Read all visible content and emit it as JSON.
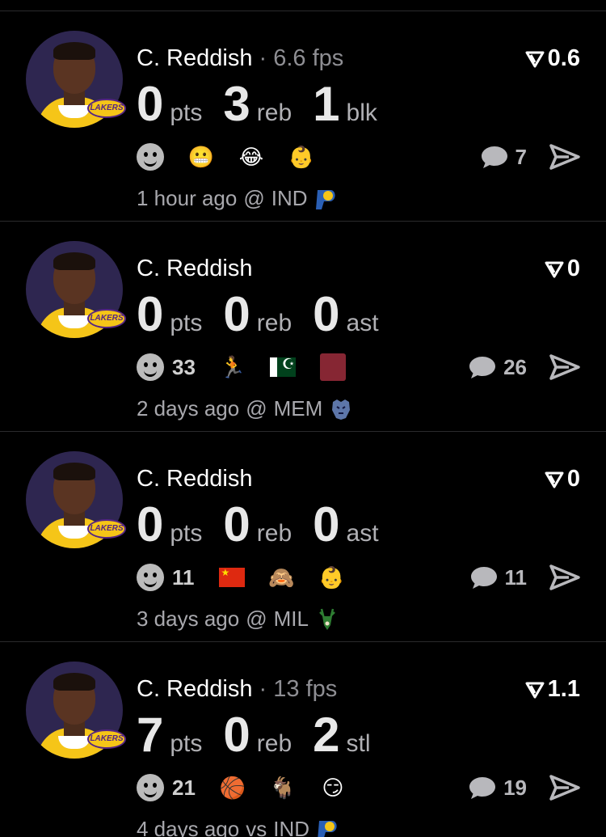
{
  "posts": [
    {
      "player": "C. Reddish",
      "fps": "6.6 fps",
      "rating": "0.6",
      "stats": [
        {
          "value": "0",
          "label": "pts"
        },
        {
          "value": "3",
          "label": "reb"
        },
        {
          "value": "1",
          "label": "blk"
        }
      ],
      "reaction_count": "",
      "reaction_emojis": [
        "😬",
        "😂",
        "👶"
      ],
      "comment_count": "7",
      "time": "1 hour ago",
      "location": "@",
      "opponent": "IND",
      "opponent_icon": "pacers-logo-icon"
    },
    {
      "player": "C. Reddish",
      "fps": "",
      "rating": "0",
      "stats": [
        {
          "value": "0",
          "label": "pts"
        },
        {
          "value": "0",
          "label": "reb"
        },
        {
          "value": "0",
          "label": "ast"
        }
      ],
      "reaction_count": "33",
      "reaction_emojis": [
        "🏃",
        "pakistan-flag",
        "maroon-square"
      ],
      "comment_count": "26",
      "time": "2 days ago",
      "location": "@",
      "opponent": "MEM",
      "opponent_icon": "grizzlies-logo-icon"
    },
    {
      "player": "C. Reddish",
      "fps": "",
      "rating": "0",
      "stats": [
        {
          "value": "0",
          "label": "pts"
        },
        {
          "value": "0",
          "label": "reb"
        },
        {
          "value": "0",
          "label": "ast"
        }
      ],
      "reaction_count": "11",
      "reaction_emojis": [
        "china-flag",
        "🙈",
        "👶"
      ],
      "comment_count": "11",
      "time": "3 days ago",
      "location": "@",
      "opponent": "MIL",
      "opponent_icon": "bucks-logo-icon"
    },
    {
      "player": "C. Reddish",
      "fps": "13 fps",
      "rating": "1.1",
      "stats": [
        {
          "value": "7",
          "label": "pts"
        },
        {
          "value": "0",
          "label": "reb"
        },
        {
          "value": "2",
          "label": "stl"
        }
      ],
      "reaction_count": "21",
      "reaction_emojis": [
        "🏀",
        "🐐",
        "😏"
      ],
      "comment_count": "19",
      "time": "4 days ago",
      "location": "vs",
      "opponent": "IND",
      "opponent_icon": "pacers-logo-icon"
    }
  ],
  "team_badge": "LAKERS",
  "colors": {
    "background": "#000000",
    "divider": "#2a2a2c",
    "muted_text": "#8e8e93",
    "lakers_gold": "#f5c518",
    "lakers_purple": "#552583"
  }
}
